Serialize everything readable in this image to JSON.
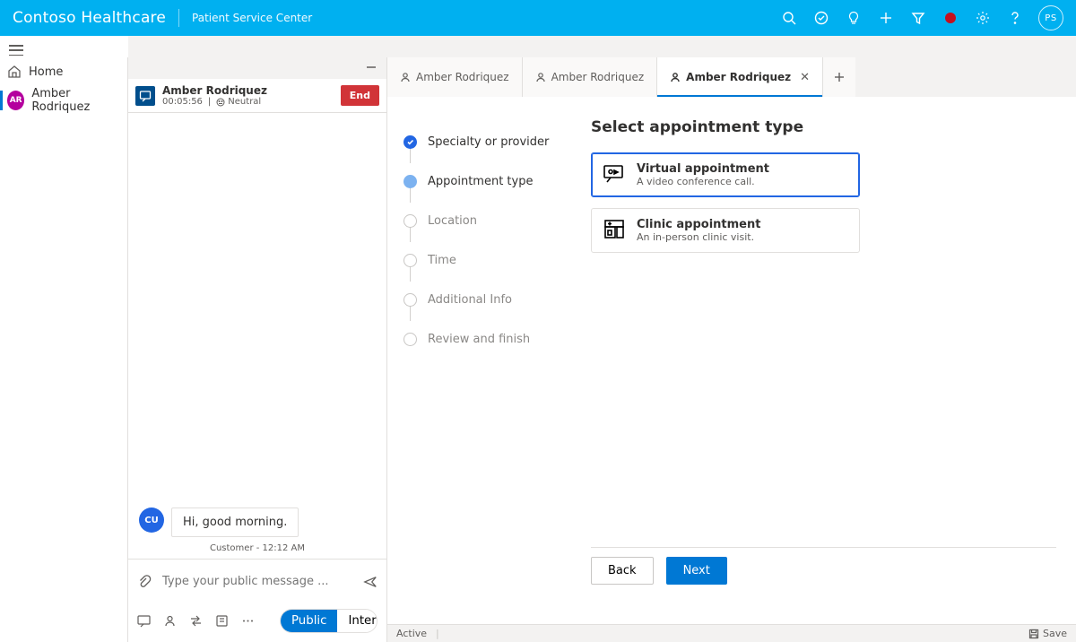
{
  "nav": {
    "brand": "Contoso Healthcare",
    "area": "Patient Service Center",
    "avatar_initials": "PS"
  },
  "sidebar": {
    "home_label": "Home",
    "patient_initials": "AR",
    "patient_label": "Amber Rodriquez"
  },
  "session": {
    "name": "Amber Rodriquez",
    "timer": "00:05:56",
    "sentiment": "Neutral",
    "end_label": "End",
    "chat_message": "Hi, good morning.",
    "chat_avatar": "CU",
    "chat_meta": "Customer - 12:12 AM",
    "input_placeholder": "Type your public message ...",
    "toggle_public": "Public",
    "toggle_internal": "Internal"
  },
  "tabs": [
    {
      "label": "Amber Rodriquez",
      "active": false
    },
    {
      "label": "Amber Rodriquez",
      "active": false
    },
    {
      "label": "Amber Rodriquez",
      "active": true
    }
  ],
  "wizard": {
    "steps": [
      {
        "label": "Specialty or provider",
        "state": "done"
      },
      {
        "label": "Appointment type",
        "state": "current"
      },
      {
        "label": "Location",
        "state": "todo"
      },
      {
        "label": "Time",
        "state": "todo"
      },
      {
        "label": "Additional Info",
        "state": "todo"
      },
      {
        "label": "Review and finish",
        "state": "todo"
      }
    ],
    "title": "Select appointment type",
    "appointments": [
      {
        "title": "Virtual appointment",
        "desc": "A video conference call.",
        "selected": true
      },
      {
        "title": "Clinic appointment",
        "desc": "An in-person clinic visit.",
        "selected": false
      }
    ],
    "back_label": "Back",
    "next_label": "Next"
  },
  "status": {
    "state": "Active",
    "save": "Save"
  }
}
